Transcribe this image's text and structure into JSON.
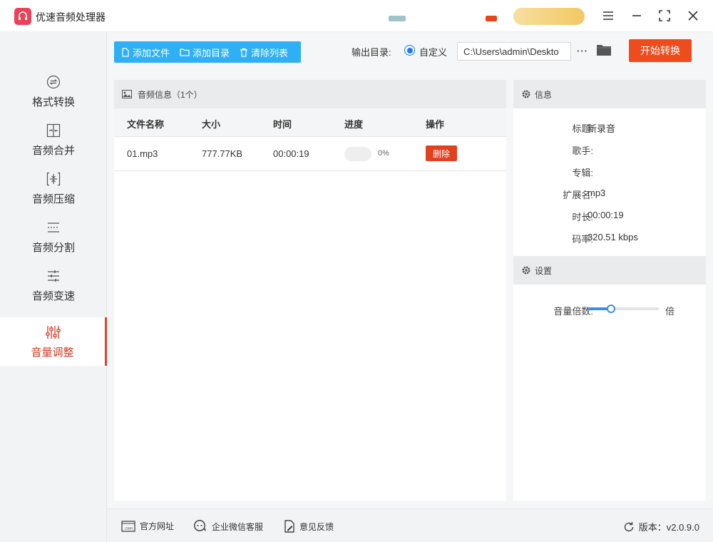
{
  "app": {
    "title": "优速音频处理器",
    "colors": {
      "accent": "#ef4c1e",
      "toolbar": "#2fb0f5",
      "active_nav": "#d23a22",
      "slider": "#3b8fe8"
    }
  },
  "window_controls": [
    "menu-icon",
    "minimize-icon",
    "maximize-icon",
    "close-icon"
  ],
  "sidebar": {
    "items": [
      {
        "label": "格式转换",
        "icon": "format-convert-icon",
        "active": false
      },
      {
        "label": "音频合并",
        "icon": "audio-merge-icon",
        "active": false
      },
      {
        "label": "音频压缩",
        "icon": "audio-compress-icon",
        "active": false
      },
      {
        "label": "音频分割",
        "icon": "audio-split-icon",
        "active": false
      },
      {
        "label": "音频变速",
        "icon": "audio-speed-icon",
        "active": false
      },
      {
        "label": "音量调整",
        "icon": "volume-adjust-icon",
        "active": true
      }
    ]
  },
  "toolbar": {
    "add_file": "添加文件",
    "add_folder": "添加目录",
    "clear_list": "清除列表",
    "output_label": "输出目录:",
    "output_option": "自定义",
    "output_path": "C:\\Users\\admin\\Deskto",
    "more": "···",
    "start_button": "开始转换"
  },
  "audio_panel": {
    "title": "音频信息（1个）",
    "columns": [
      "文件名称",
      "大小",
      "时间",
      "进度",
      "操作"
    ],
    "rows": [
      {
        "name": "01.mp3",
        "size": "777.77KB",
        "time": "00:00:19",
        "progress": 0,
        "progress_text": "0%",
        "action": "删除"
      }
    ]
  },
  "info": {
    "title": "信息",
    "fields": [
      {
        "label": "标题:",
        "value": "新录音"
      },
      {
        "label": "歌手:",
        "value": ""
      },
      {
        "label": "专辑:",
        "value": ""
      },
      {
        "label": "扩展名:",
        "value": "mp3"
      },
      {
        "label": "时长:",
        "value": "00:00:19"
      },
      {
        "label": "码率:",
        "value": "320.51 kbps"
      }
    ]
  },
  "settings": {
    "title": "设置",
    "volume_label": "音量倍数:",
    "volume_unit": "倍",
    "volume_slider_fraction": 0.33
  },
  "footer": {
    "website": "官方网址",
    "wechat": "企业微信客服",
    "feedback": "意见反馈",
    "version_label": "版本：v2.0.9.0"
  }
}
